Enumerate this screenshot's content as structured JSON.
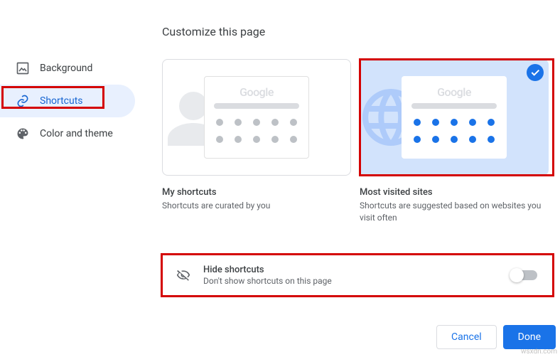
{
  "title": "Customize this page",
  "sidebar": {
    "items": [
      {
        "label": "Background"
      },
      {
        "label": "Shortcuts"
      },
      {
        "label": "Color and theme"
      }
    ],
    "active_index": 1
  },
  "options": [
    {
      "id": "my-shortcuts",
      "mini_text": "Google",
      "heading": "My shortcuts",
      "sub": "Shortcuts are curated by you",
      "selected": false
    },
    {
      "id": "most-visited",
      "mini_text": "Google",
      "heading": "Most visited sites",
      "sub": "Shortcuts are suggested based on websites you visit often",
      "selected": true
    }
  ],
  "hide": {
    "heading": "Hide shortcuts",
    "sub": "Don't show shortcuts on this page",
    "enabled": false
  },
  "buttons": {
    "cancel": "Cancel",
    "done": "Done"
  },
  "watermark": "wsxdn.com"
}
